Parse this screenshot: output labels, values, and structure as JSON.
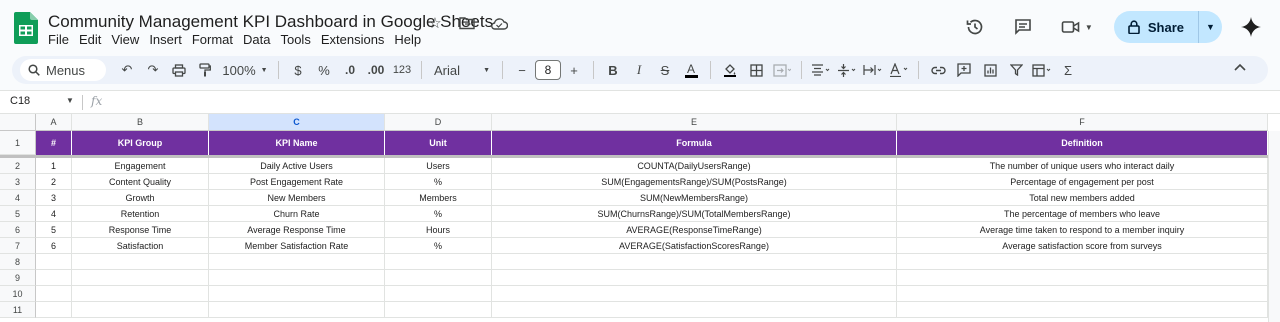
{
  "app": {
    "title": "Community Management KPI Dashboard in Google Sheets",
    "menu": [
      "File",
      "Edit",
      "View",
      "Insert",
      "Format",
      "Data",
      "Tools",
      "Extensions",
      "Help"
    ],
    "share_label": "Share"
  },
  "toolbar": {
    "search_label": "Menus",
    "zoom": "100%",
    "currency": "$",
    "percent": "%",
    "dec_decrease": ".0",
    "dec_increase": ".00",
    "number_format": "123",
    "font": "Arial",
    "font_size": "8"
  },
  "formula_bar": {
    "cell_ref": "C18",
    "fx": "fx",
    "content": ""
  },
  "sheet": {
    "columns": [
      "A",
      "B",
      "C",
      "D",
      "E",
      "F"
    ],
    "selected_column": "C",
    "row_numbers": [
      "1",
      "2",
      "3",
      "4",
      "5",
      "6",
      "7",
      "8",
      "9",
      "10",
      "11"
    ],
    "headers": [
      "#",
      "KPI Group",
      "KPI Name",
      "Unit",
      "Formula",
      "Definition"
    ],
    "rows": [
      [
        "1",
        "Engagement",
        "Daily Active Users",
        "Users",
        "COUNTA(DailyUsersRange)",
        "The number of unique users who interact daily"
      ],
      [
        "2",
        "Content Quality",
        "Post Engagement Rate",
        "%",
        "SUM(EngagementsRange)/SUM(PostsRange)",
        "Percentage of engagement per post"
      ],
      [
        "3",
        "Growth",
        "New Members",
        "Members",
        "SUM(NewMembersRange)",
        "Total new members added"
      ],
      [
        "4",
        "Retention",
        "Churn Rate",
        "%",
        "SUM(ChurnsRange)/SUM(TotalMembersRange)",
        "The percentage of members who leave"
      ],
      [
        "5",
        "Response Time",
        "Average Response Time",
        "Hours",
        "AVERAGE(ResponseTimeRange)",
        "Average time taken to respond to a member inquiry"
      ],
      [
        "6",
        "Satisfaction",
        "Member Satisfaction Rate",
        "%",
        "AVERAGE(SatisfactionScoresRange)",
        "Average satisfaction score from surveys"
      ]
    ]
  },
  "colors": {
    "header_fill": "#7030a0",
    "header_text": "#ffffff",
    "share_button": "#c2e7ff",
    "logo_green": "#0f9d58"
  }
}
